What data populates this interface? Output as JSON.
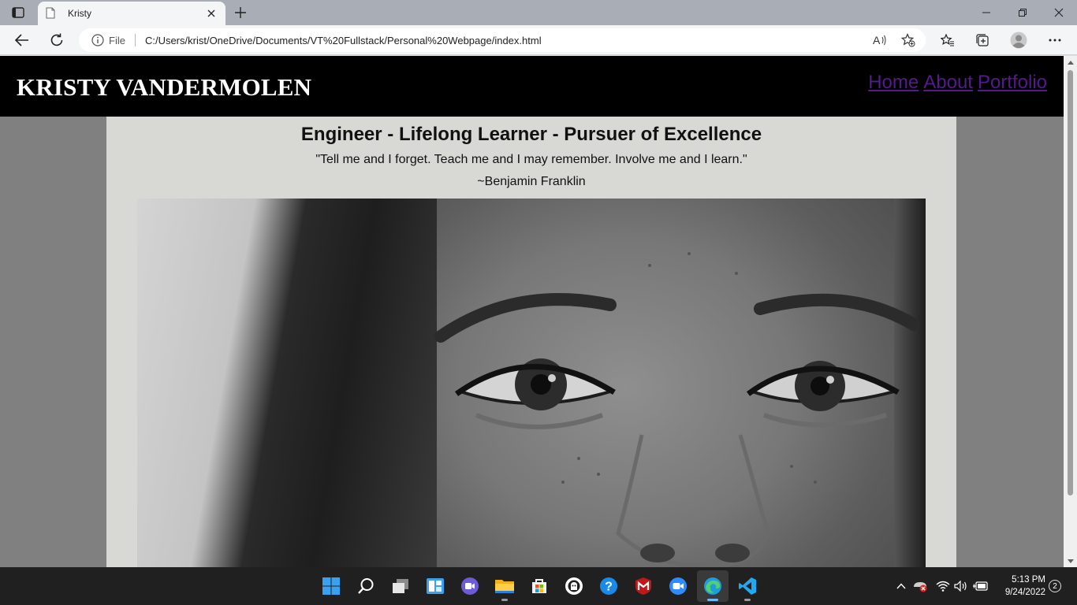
{
  "browser": {
    "tab_title": "Kristy",
    "address": {
      "scheme_label": "File",
      "url": "C:/Users/krist/OneDrive/Documents/VT%20Fullstack/Personal%20Webpage/index.html"
    }
  },
  "site": {
    "name": "KRISTY VANDERMOLEN",
    "nav": [
      "Home",
      "About",
      "Portfolio"
    ],
    "headline": "Engineer - Lifelong Learner - Pursuer of Excellence",
    "quote": "\"Tell me and I forget. Teach me and I may remember. Involve me and I learn.\"",
    "quote_author": "~Benjamin Franklin",
    "link_color": "#551a8b",
    "header_bg": "#000000",
    "content_bg": "#d8d8d4"
  },
  "taskbar": {
    "apps": [
      "start-icon",
      "search-icon",
      "task-view-icon",
      "widgets-icon",
      "chat-icon",
      "file-explorer-icon",
      "store-icon",
      "github-icon",
      "help-icon",
      "mcafee-icon",
      "zoom-icon",
      "edge-icon",
      "vscode-icon"
    ],
    "clock": {
      "time": "5:13 PM",
      "date": "9/24/2022"
    },
    "notifications": "2"
  }
}
